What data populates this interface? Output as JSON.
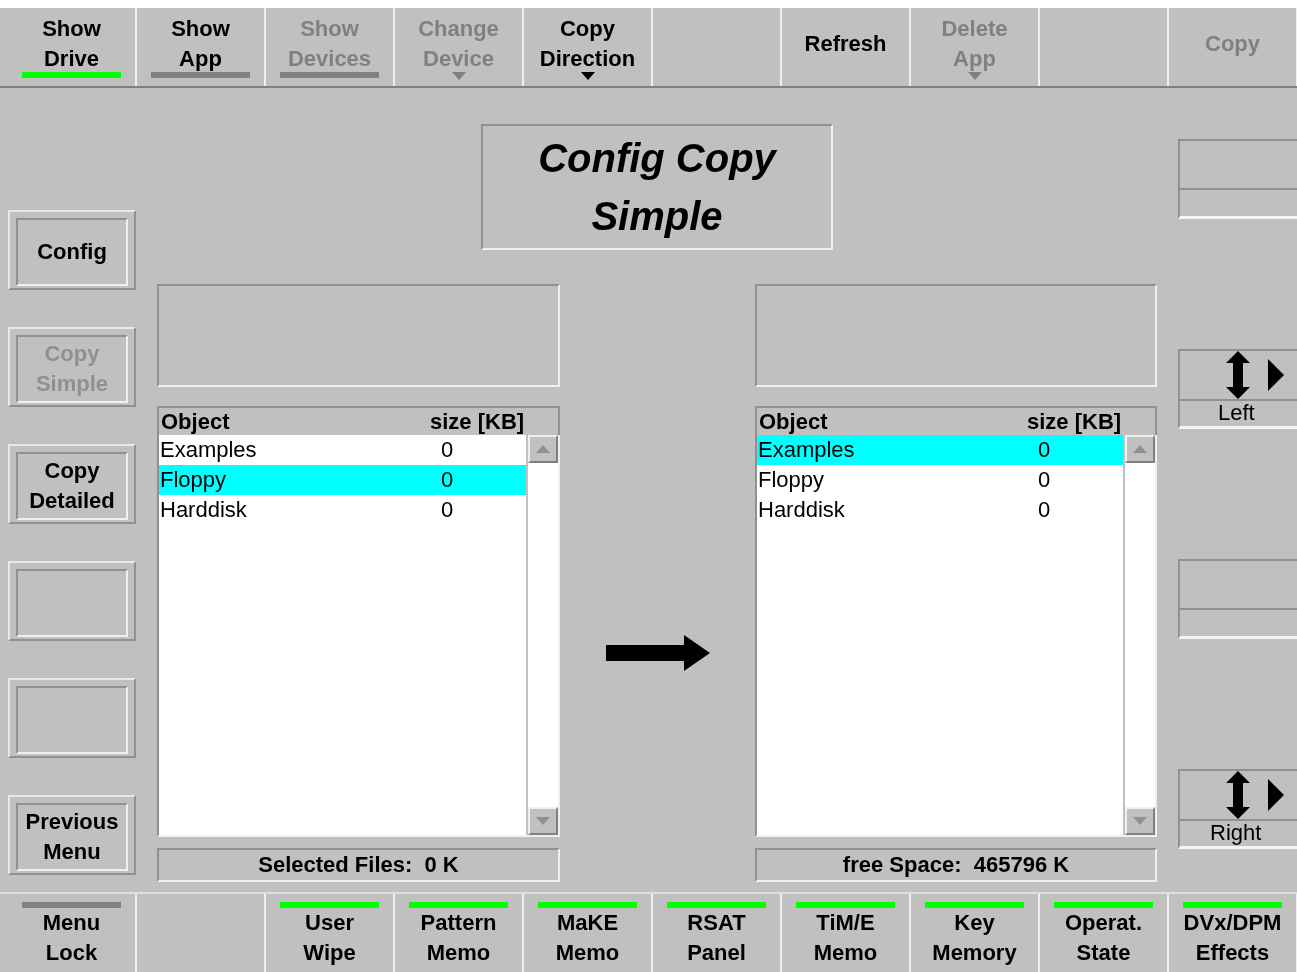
{
  "top_bar": [
    {
      "kind": "button",
      "label": "Show\nDrive",
      "disabled": false,
      "color": "#00ff00",
      "dropdown": false
    },
    {
      "kind": "button",
      "label": "Show\nApp",
      "disabled": false,
      "color": "#808080",
      "dropdown": false
    },
    {
      "kind": "button",
      "label": "Show\nDevices",
      "disabled": true,
      "color": "#808080",
      "dropdown": false
    },
    {
      "kind": "button",
      "label": "Change\nDevice",
      "disabled": true,
      "dropdown": true
    },
    {
      "kind": "button",
      "label": "Copy\nDirection",
      "disabled": false,
      "dropdown": true
    },
    {
      "kind": "blank"
    },
    {
      "kind": "button",
      "label": "Refresh",
      "disabled": false,
      "dropdown": false
    },
    {
      "kind": "button",
      "label": "Delete\nApp",
      "disabled": true,
      "dropdown": true
    },
    {
      "kind": "blank"
    },
    {
      "kind": "button",
      "label": "Copy",
      "disabled": true,
      "dropdown": false
    }
  ],
  "left_menu": [
    {
      "kind": "button",
      "label": "Config",
      "disabled": false
    },
    {
      "kind": "button",
      "label": "Copy\nSimple",
      "disabled": true
    },
    {
      "kind": "button",
      "label": "Copy\nDetailed",
      "disabled": false
    },
    {
      "kind": "blank"
    },
    {
      "kind": "blank"
    },
    {
      "kind": "button",
      "label": "Previous\nMenu",
      "disabled": false
    }
  ],
  "title": "Config Copy\nSimple",
  "source": {
    "columns": [
      "Object",
      "size [KB]"
    ],
    "rows": [
      {
        "name": "Examples",
        "size": "0",
        "selected": false
      },
      {
        "name": "Floppy",
        "size": "0",
        "selected": true
      },
      {
        "name": "Harddisk",
        "size": "0",
        "selected": false
      }
    ],
    "status": "Selected Files:  0 K"
  },
  "target": {
    "columns": [
      "Object",
      "size [KB]"
    ],
    "rows": [
      {
        "name": "Examples",
        "size": "0",
        "selected": true
      },
      {
        "name": "Floppy",
        "size": "0",
        "selected": false
      },
      {
        "name": "Harddisk",
        "size": "0",
        "selected": false
      }
    ],
    "status": "free Space:  465796 K"
  },
  "right_menu": [
    {
      "kind": "blank"
    },
    {
      "kind": "selector",
      "label": "Left"
    },
    {
      "kind": "blank"
    },
    {
      "kind": "selector",
      "label": "Right"
    }
  ],
  "bottom_bar": [
    {
      "kind": "button",
      "label": "Menu\nLock",
      "color": "#808080"
    },
    {
      "kind": "blank"
    },
    {
      "kind": "button",
      "label": "User\nWipe",
      "color": "#00ff00"
    },
    {
      "kind": "button",
      "label": "Pattern\nMemo",
      "color": "#00ff00"
    },
    {
      "kind": "button",
      "label": "MaKE\nMemo",
      "color": "#00ff00"
    },
    {
      "kind": "button",
      "label": "RSAT\nPanel",
      "color": "#00ff00"
    },
    {
      "kind": "button",
      "label": "TiM/E\nMemo",
      "color": "#00ff00"
    },
    {
      "kind": "button",
      "label": "Key\nMemory",
      "color": "#00ff00"
    },
    {
      "kind": "button",
      "label": "Operat.\nState",
      "color": "#00ff00"
    },
    {
      "kind": "button",
      "label": "DVx/DPM\nEffects",
      "color": "#00ff00"
    }
  ]
}
